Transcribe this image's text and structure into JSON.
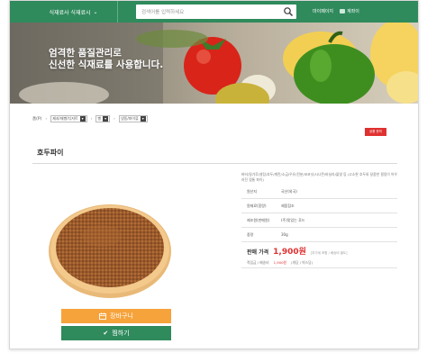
{
  "topbar": {
    "menu_label": "식재료사 식재료시",
    "search_placeholder": "검색어를 입력하세요",
    "login_link": "마이페이지",
    "join_link": "계좌이"
  },
  "banner": {
    "line1": "엄격한 품질관리로",
    "line2": "신선한 식재료를 사용합니다."
  },
  "breadcrumb": {
    "home": "홈(P)",
    "sel1": "제과/제빵/디저트",
    "sel2": "빵",
    "sel3": "냉동/파이류"
  },
  "small_button_label": "상품 문의",
  "product": {
    "name": "호두파이",
    "description": "버터/밀가루/설탕/호두/계란/소금/우유/전분/코코넛/시나몬/바닐라/물엿 등 (고소한 호두와 달콤한 필링이 어우러진 정통 파이)",
    "rows": [
      {
        "label": "원산지",
        "value": "국산(외국)"
      },
      {
        "label": "원재료(함량)",
        "value": "제품참조"
      },
      {
        "label": "제조원(판매원)",
        "value": "(주)맛있는 푸드"
      },
      {
        "label": "중량",
        "value": "30g"
      }
    ],
    "price_label": "판매 가격",
    "price_value": "1,900원",
    "price_note": "[부가세 포함 / 배송비 별도]",
    "sub_label": "적립금 / 배송비",
    "sub_value": "1,900원",
    "sub_note": "(개당 / 박스당)"
  },
  "buttons": {
    "cart": "장바구니",
    "wish": "찜하기"
  },
  "colors": {
    "green": "#2f8a5c",
    "orange": "#f6a33c",
    "red": "#e03131"
  }
}
